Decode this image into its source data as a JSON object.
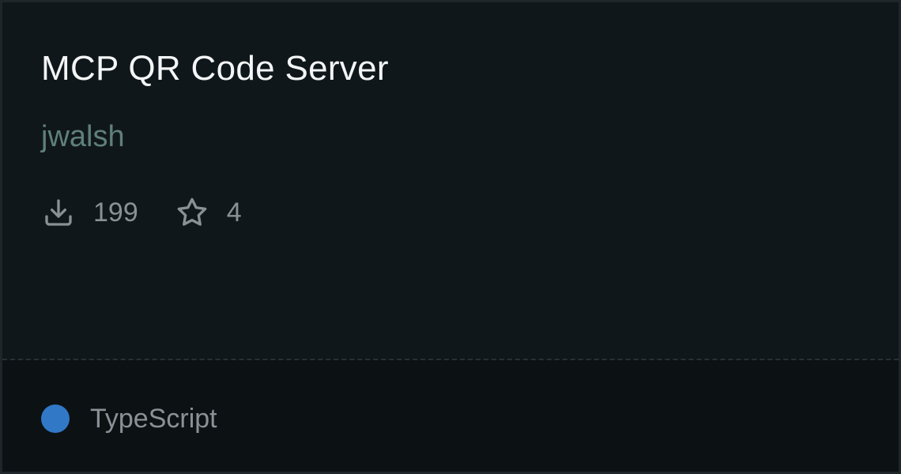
{
  "card": {
    "title": "MCP QR Code Server",
    "author": "jwalsh",
    "stats": {
      "downloads": {
        "icon": "download-icon",
        "value": "199"
      },
      "stars": {
        "icon": "star-icon",
        "value": "4"
      }
    },
    "language": {
      "name": "TypeScript",
      "color": "#3178c6"
    }
  },
  "colors": {
    "background": "#10171a",
    "footer_background": "#0c1114",
    "title": "#f3f5f6",
    "author": "#5f8079",
    "muted": "#8a9196"
  }
}
